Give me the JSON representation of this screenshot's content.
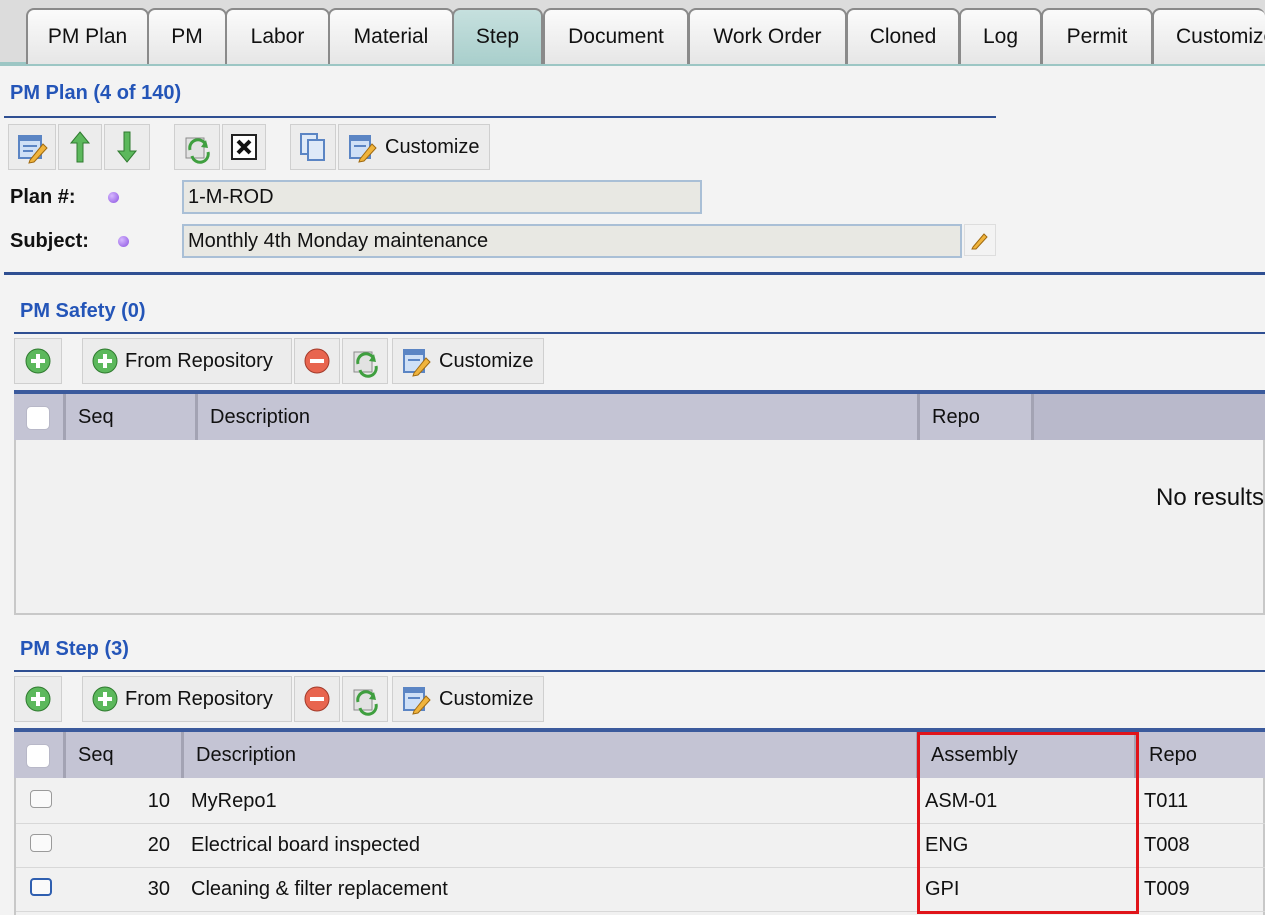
{
  "tabs": [
    "PM Plan",
    "PM",
    "Labor",
    "Material",
    "Step",
    "Document",
    "Work Order",
    "Cloned",
    "Log",
    "Permit",
    "Customize"
  ],
  "active_tab": "Step",
  "plan": {
    "title": "PM Plan (4 of 140)",
    "customize_label": "Customize",
    "plan_label": "Plan #:",
    "plan_value": "1-M-ROD",
    "subject_label": "Subject:",
    "subject_value": "Monthly 4th Monday maintenance"
  },
  "safety": {
    "title": "PM Safety (0)",
    "from_repository_label": "From Repository",
    "customize_label": "Customize",
    "columns": [
      "Seq",
      "Description",
      "Repo"
    ],
    "empty_text": "No results"
  },
  "step": {
    "title": "PM Step (3)",
    "from_repository_label": "From Repository",
    "customize_label": "Customize",
    "columns": [
      "Seq",
      "Description",
      "Assembly",
      "Repo"
    ],
    "rows": [
      {
        "seq": "10",
        "description": "MyRepo1",
        "assembly": "ASM-01",
        "repo": "T011"
      },
      {
        "seq": "20",
        "description": "Electrical board inspected",
        "assembly": "ENG",
        "repo": "T008"
      },
      {
        "seq": "30",
        "description": "Cleaning & filter replacement",
        "assembly": "GPI",
        "repo": "T009"
      }
    ]
  },
  "colors": {
    "accent_blue": "#2455b8",
    "active_tab": "#a9cfcc",
    "highlight_red": "#e0141a",
    "required_dot": "#8b52e0"
  }
}
